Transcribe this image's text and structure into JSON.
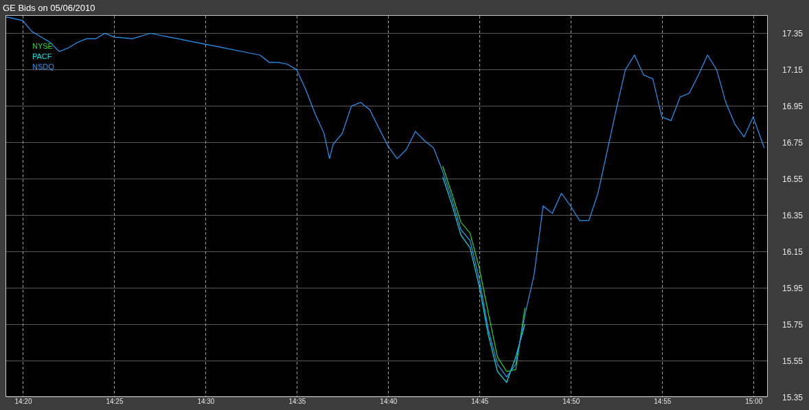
{
  "title": "GE Bids on 05/06/2010",
  "chart_data": {
    "type": "line",
    "grid": true,
    "xlim": [
      859.06,
      900.8
    ],
    "ylim": [
      15.35,
      17.45
    ],
    "xticks": [
      {
        "value": 860,
        "label": "14:20"
      },
      {
        "value": 865,
        "label": "14:25"
      },
      {
        "value": 870,
        "label": "14:30"
      },
      {
        "value": 875,
        "label": "14:35"
      },
      {
        "value": 880,
        "label": "14:40"
      },
      {
        "value": 885,
        "label": "14:45"
      },
      {
        "value": 890,
        "label": "14:50"
      },
      {
        "value": 895,
        "label": "14:55"
      },
      {
        "value": 900,
        "label": "15:00"
      }
    ],
    "yticks": [
      {
        "value": 15.35,
        "label": "15.35"
      },
      {
        "value": 15.55,
        "label": "15.55"
      },
      {
        "value": 15.75,
        "label": "15.75"
      },
      {
        "value": 15.95,
        "label": "15.95"
      },
      {
        "value": 16.15,
        "label": "16.15"
      },
      {
        "value": 16.35,
        "label": "16.35"
      },
      {
        "value": 16.55,
        "label": "16.55"
      },
      {
        "value": 16.75,
        "label": "16.75"
      },
      {
        "value": 16.95,
        "label": "16.95"
      },
      {
        "value": 17.15,
        "label": "17.15"
      },
      {
        "value": 17.35,
        "label": "17.35"
      }
    ],
    "x": [
      859.1,
      860,
      860.5,
      861,
      861.5,
      862,
      862.5,
      863,
      863.5,
      864,
      864.5,
      865,
      866,
      867,
      868,
      869,
      870,
      871,
      872,
      873,
      873.5,
      874,
      874.5,
      875,
      875.5,
      876,
      876.5,
      876.8,
      877,
      877.5,
      878,
      878.5,
      879,
      879.5,
      880,
      880.5,
      881,
      881.5,
      882,
      882.5,
      883,
      883.5,
      884,
      884.5,
      885,
      885.5,
      886,
      886.5,
      887,
      887.5,
      888,
      888.5,
      889,
      889.5,
      890,
      890.5,
      891,
      891.5,
      892,
      892.5,
      893,
      893.5,
      894,
      894.5,
      895,
      895.5,
      896,
      896.5,
      897,
      897.5,
      898,
      898.5,
      899,
      899.5,
      900,
      900.6
    ],
    "series": [
      {
        "name": "NYSE",
        "color": "#22dd22",
        "values": [
          null,
          null,
          null,
          null,
          null,
          null,
          null,
          null,
          null,
          null,
          null,
          null,
          null,
          null,
          null,
          null,
          null,
          null,
          null,
          null,
          null,
          null,
          null,
          null,
          null,
          null,
          null,
          null,
          null,
          null,
          null,
          null,
          null,
          null,
          null,
          null,
          null,
          null,
          null,
          null,
          16.62,
          16.47,
          16.31,
          16.25,
          16.06,
          15.81,
          15.57,
          15.49,
          15.5,
          15.84,
          null,
          null,
          null,
          null,
          null,
          null,
          null,
          null,
          null,
          null,
          null,
          null,
          null,
          null,
          null,
          null,
          null,
          null,
          null,
          null,
          null,
          null,
          null,
          null,
          null,
          null
        ]
      },
      {
        "name": "PACF",
        "color": "#00e5e5",
        "values": [
          null,
          null,
          null,
          null,
          null,
          null,
          null,
          null,
          null,
          null,
          null,
          null,
          null,
          null,
          null,
          null,
          null,
          null,
          null,
          null,
          null,
          null,
          null,
          null,
          null,
          null,
          null,
          null,
          null,
          null,
          null,
          null,
          null,
          null,
          null,
          null,
          null,
          null,
          null,
          null,
          16.56,
          16.41,
          16.24,
          16.17,
          15.96,
          15.69,
          15.49,
          15.43,
          15.57,
          15.75,
          null,
          null,
          null,
          null,
          null,
          null,
          null,
          null,
          null,
          null,
          null,
          null,
          null,
          null,
          null,
          null,
          null,
          null,
          null,
          null,
          null,
          null,
          null,
          null,
          null,
          null
        ]
      },
      {
        "name": "NSDQ",
        "color": "#1e9bff",
        "values": [
          17.44,
          17.42,
          17.36,
          17.33,
          17.3,
          17.25,
          17.27,
          17.3,
          17.32,
          17.32,
          17.35,
          17.33,
          17.32,
          17.35,
          17.33,
          17.31,
          17.29,
          17.27,
          17.25,
          17.23,
          17.19,
          17.19,
          17.18,
          17.15,
          17.04,
          16.91,
          16.8,
          16.66,
          16.74,
          16.8,
          16.95,
          16.97,
          16.93,
          16.83,
          16.73,
          16.66,
          16.71,
          16.81,
          16.76,
          16.72,
          16.59,
          16.44,
          16.27,
          16.21,
          16.0,
          15.72,
          15.53,
          15.46,
          15.53,
          15.8,
          16.02,
          16.4,
          16.36,
          16.47,
          16.4,
          16.32,
          16.32,
          16.47,
          16.7,
          16.93,
          17.15,
          17.23,
          17.12,
          17.1,
          16.89,
          16.87,
          17.0,
          17.02,
          17.12,
          17.23,
          17.15,
          16.97,
          16.85,
          16.78,
          16.89,
          16.72
        ]
      }
    ]
  }
}
